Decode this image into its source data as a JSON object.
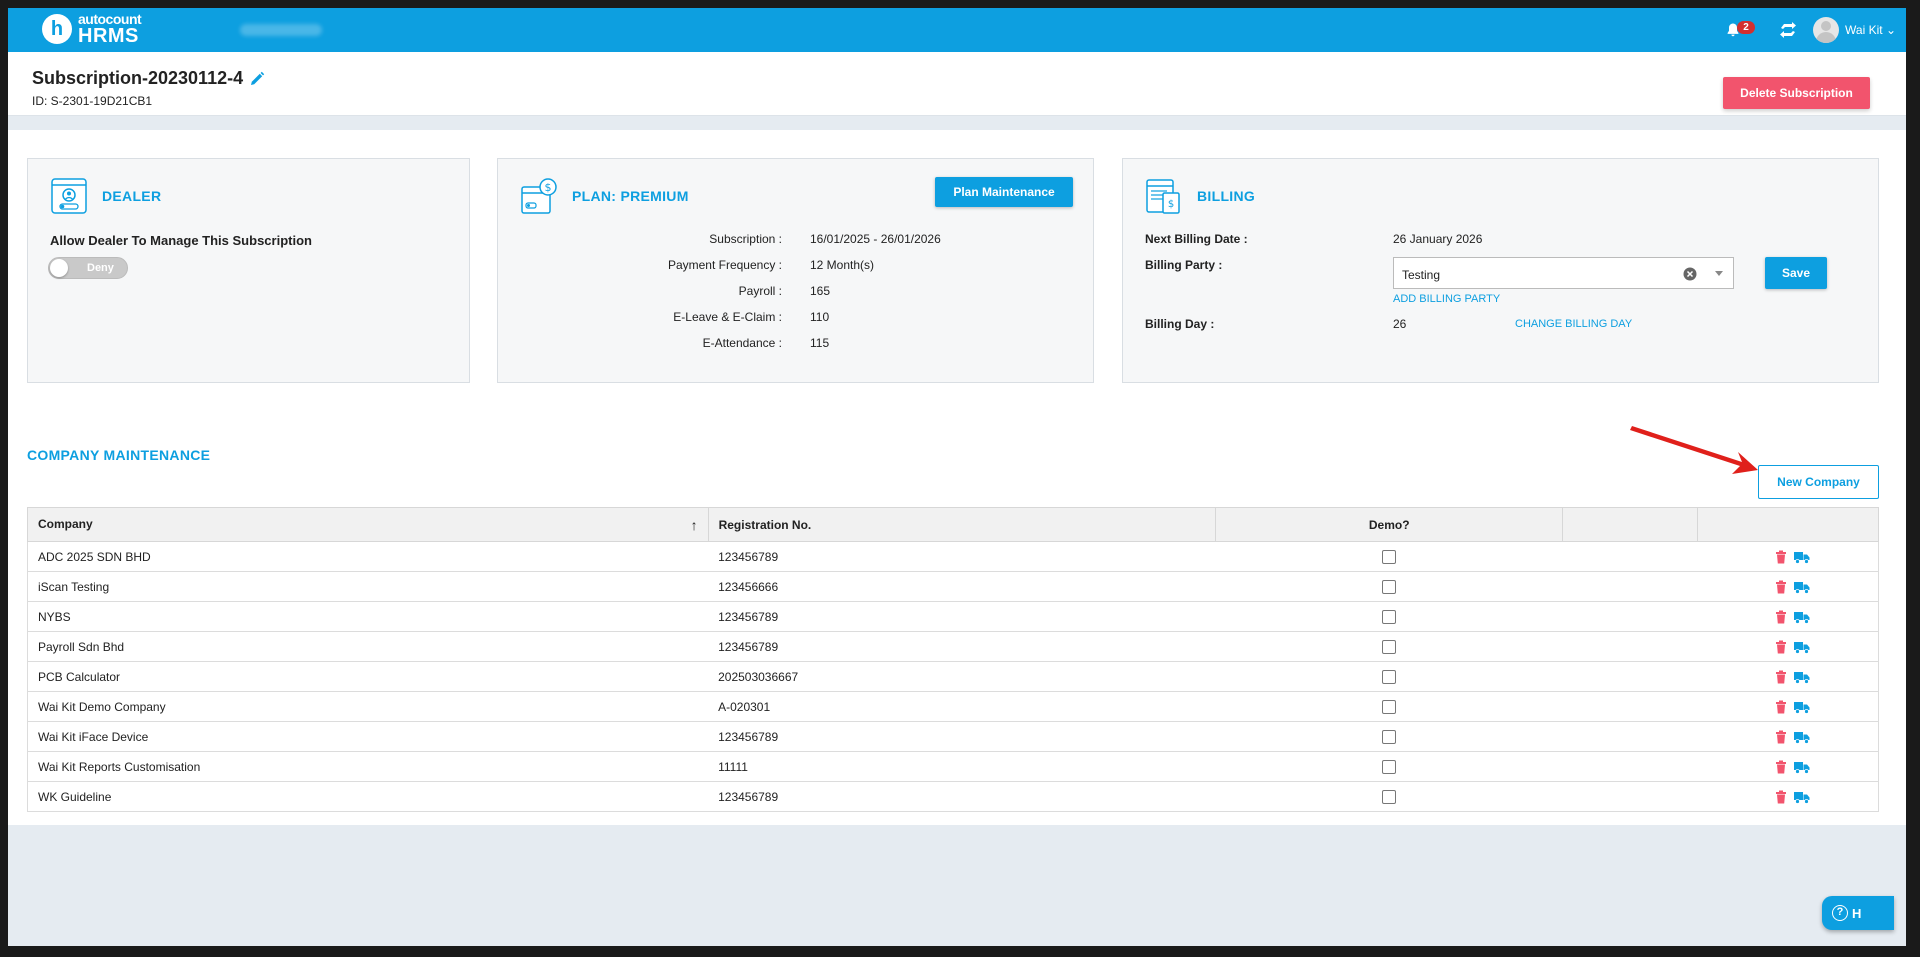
{
  "brand": {
    "logo_letter": "h",
    "name_top": "autocount",
    "name_bottom": "HRMS"
  },
  "topbar": {
    "notification_count": "2",
    "user_name": "Wai Kit"
  },
  "header": {
    "title": "Subscription-20230112-4",
    "id_text": "ID: S-2301-19D21CB1",
    "delete_label": "Delete Subscription"
  },
  "dealer": {
    "title": "DEALER",
    "allow_label": "Allow Dealer To Manage This Subscription",
    "toggle_text": "Deny"
  },
  "plan": {
    "title": "PLAN: PREMIUM",
    "button_label": "Plan Maintenance",
    "rows": [
      {
        "key": "Subscription :",
        "value": "16/01/2025 - 26/01/2026"
      },
      {
        "key": "Payment Frequency :",
        "value": "12 Month(s)"
      },
      {
        "key": "Payroll :",
        "value": "165"
      },
      {
        "key": "E-Leave & E-Claim :",
        "value": "110"
      },
      {
        "key": "E-Attendance :",
        "value": "115"
      }
    ]
  },
  "billing": {
    "title": "BILLING",
    "next_date_label": "Next Billing Date :",
    "next_date_value": "26 January 2026",
    "party_label": "Billing Party :",
    "party_value": "Testing",
    "add_party_link": "ADD BILLING PARTY",
    "save_label": "Save",
    "day_label": "Billing Day :",
    "day_value": "26",
    "change_day_link": "CHANGE BILLING DAY"
  },
  "company_maintenance": {
    "title": "COMPANY MAINTENANCE",
    "new_button": "New Company",
    "columns": {
      "company": "Company",
      "registration": "Registration No.",
      "demo": "Demo?"
    },
    "sort_glyph": "↑",
    "rows": [
      {
        "company": "ADC 2025 SDN BHD",
        "registration": "123456789"
      },
      {
        "company": "iScan Testing",
        "registration": "123456666"
      },
      {
        "company": "NYBS",
        "registration": "123456789"
      },
      {
        "company": "Payroll Sdn Bhd",
        "registration": "123456789"
      },
      {
        "company": "PCB Calculator",
        "registration": "202503036667"
      },
      {
        "company": "Wai Kit Demo Company",
        "registration": "A-020301"
      },
      {
        "company": "Wai Kit iFace Device",
        "registration": "123456789"
      },
      {
        "company": "Wai Kit Reports Customisation",
        "registration": "11111"
      },
      {
        "company": "WK Guideline",
        "registration": "123456789"
      }
    ]
  },
  "help": {
    "label": "H"
  },
  "colors": {
    "primary": "#0d9fe0",
    "danger": "#f2546d",
    "badge": "#d32f2f",
    "arrow": "#e0201b"
  }
}
